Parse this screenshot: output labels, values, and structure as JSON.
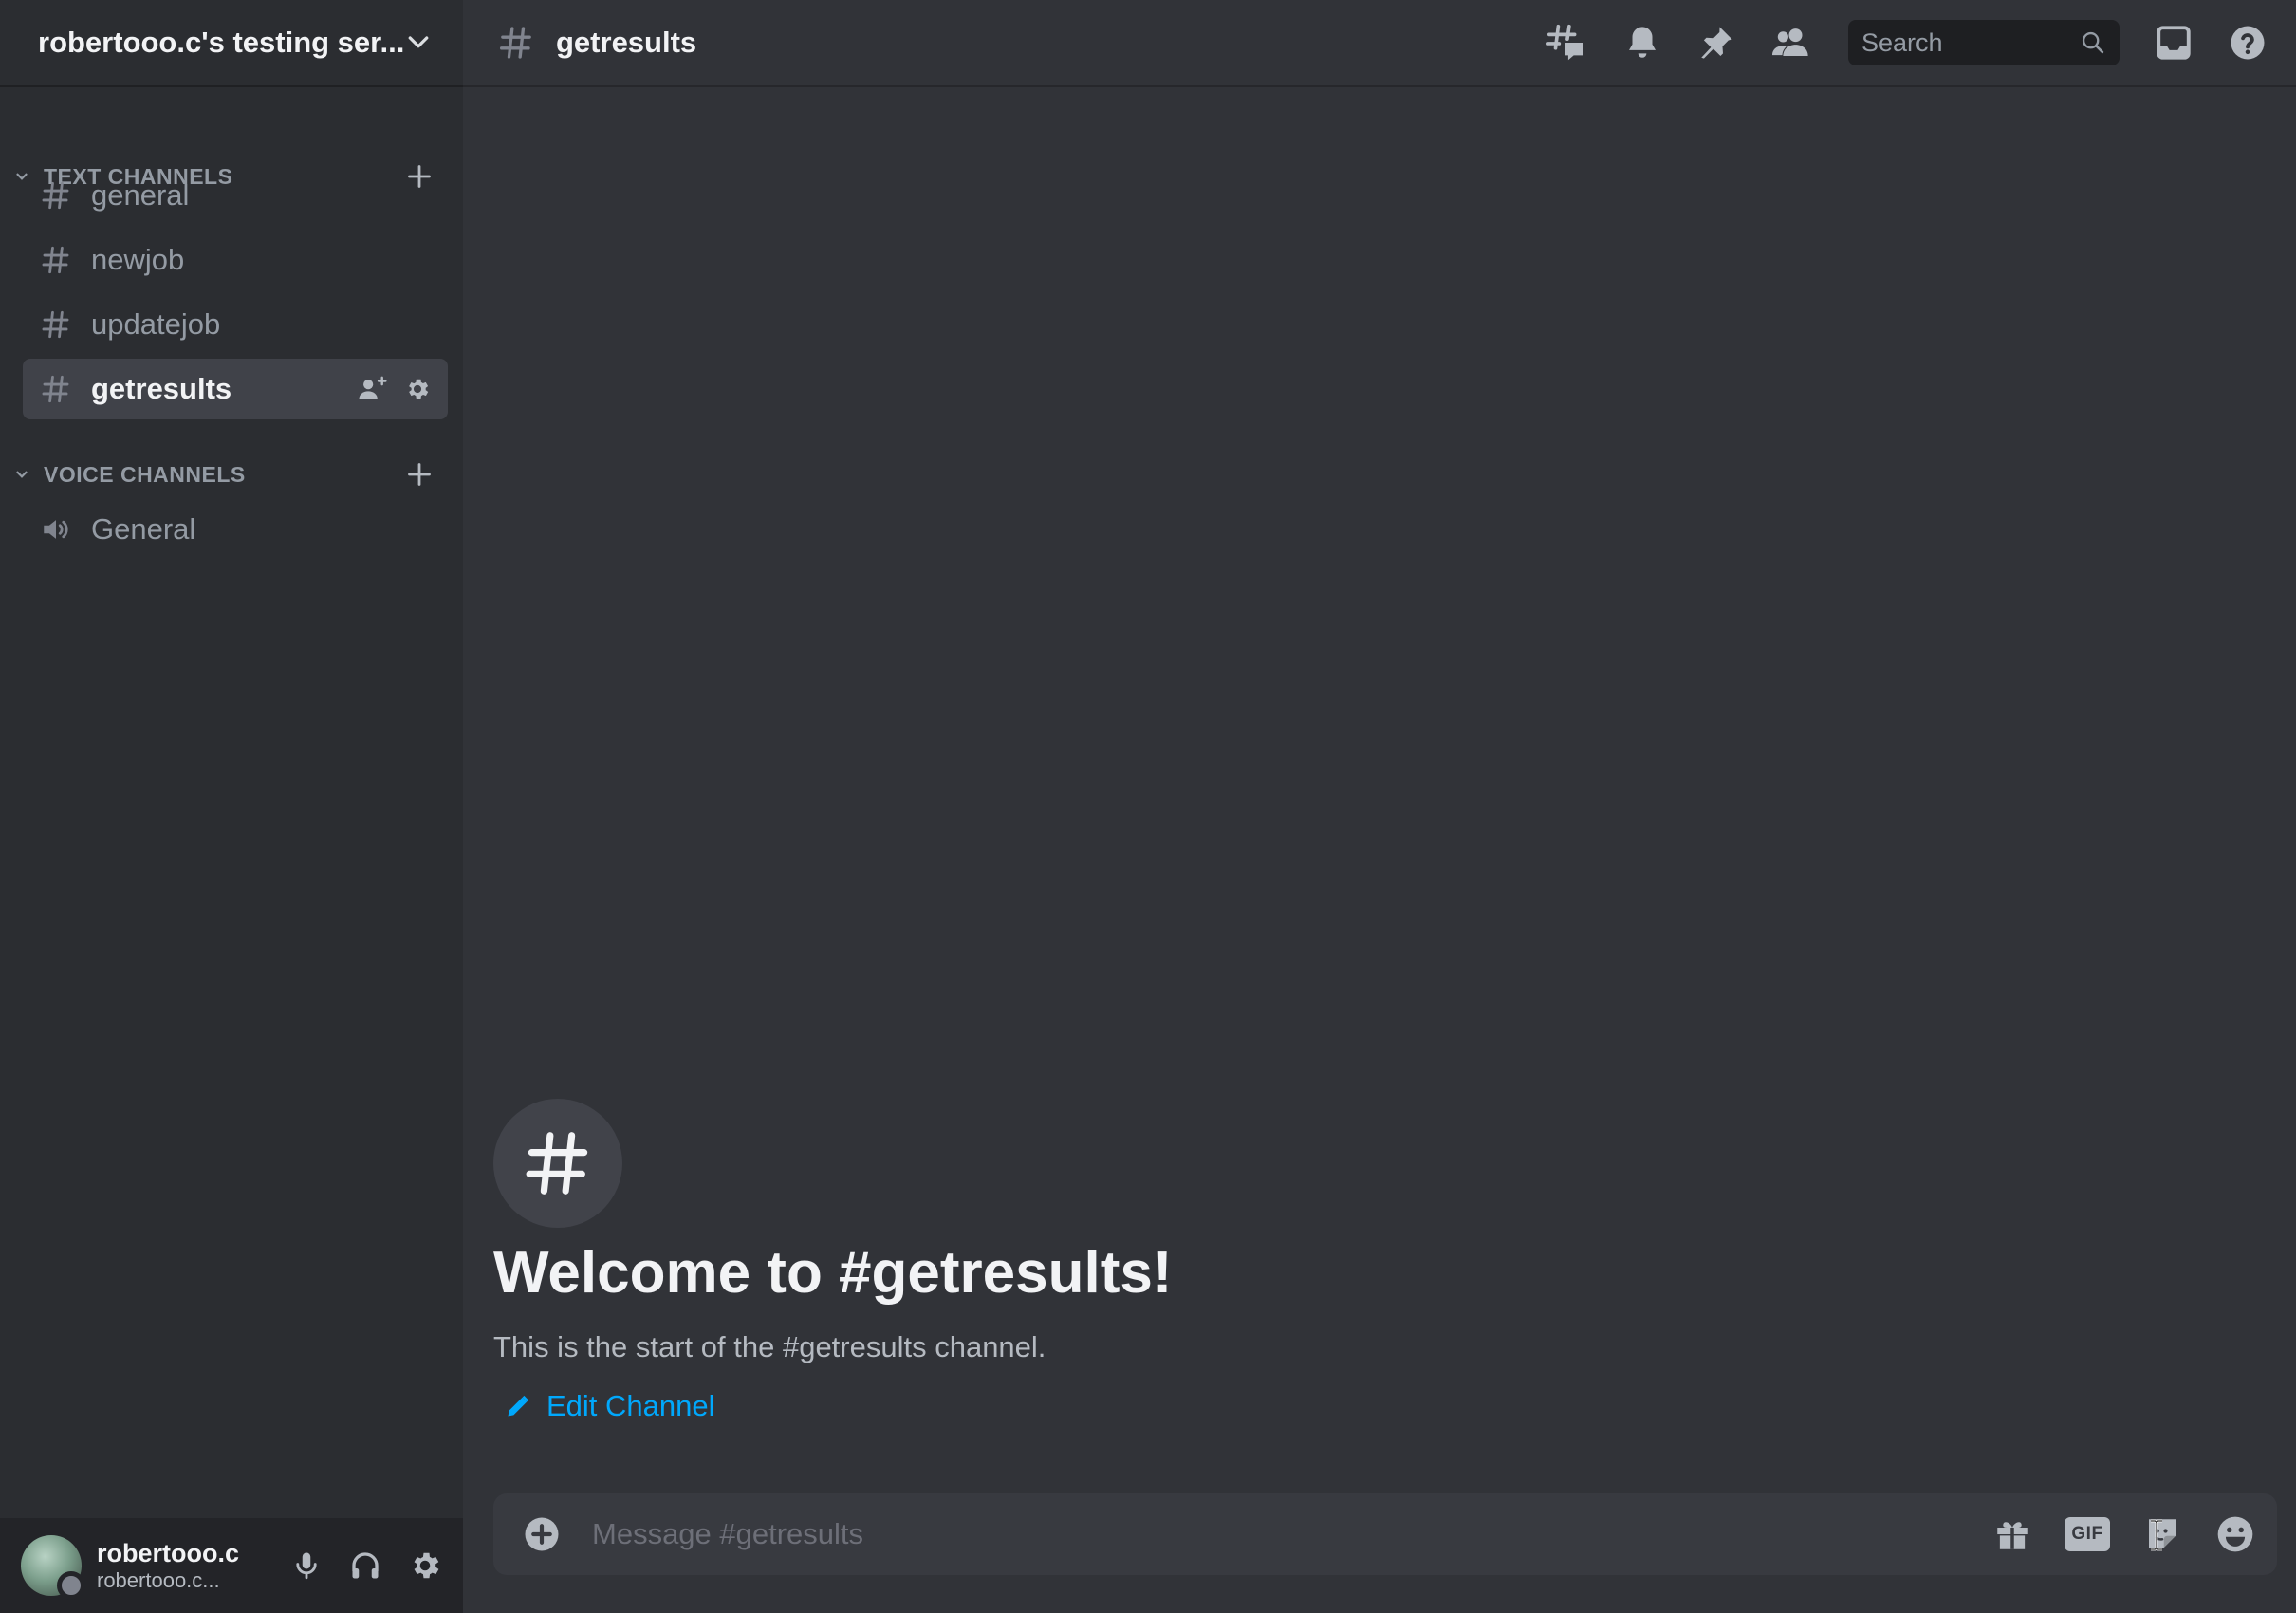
{
  "server": {
    "name": "robertooo.c's testing ser..."
  },
  "categories": [
    {
      "label": "TEXT CHANNELS"
    },
    {
      "label": "VOICE CHANNELS"
    }
  ],
  "text_channels": [
    {
      "label": "general",
      "active": false
    },
    {
      "label": "newjob",
      "active": false
    },
    {
      "label": "updatejob",
      "active": false
    },
    {
      "label": "getresults",
      "active": true
    }
  ],
  "voice_channels": [
    {
      "label": "General"
    }
  ],
  "user": {
    "display_name": "robertooo.c",
    "username": "robertooo.c...",
    "status": "offline"
  },
  "header": {
    "channel_name": "getresults",
    "search_placeholder": "Search"
  },
  "welcome": {
    "title": "Welcome to #getresults!",
    "subtitle": "This is the start of the #getresults channel.",
    "edit_label": "Edit Channel"
  },
  "composer": {
    "placeholder": "Message #getresults",
    "gif_label": "GIF"
  },
  "colors": {
    "sidebar_bg": "#2b2d31",
    "main_bg": "#313338",
    "active_channel_bg": "#404249",
    "link": "#00a8fc",
    "muted_text": "#949ba4"
  }
}
